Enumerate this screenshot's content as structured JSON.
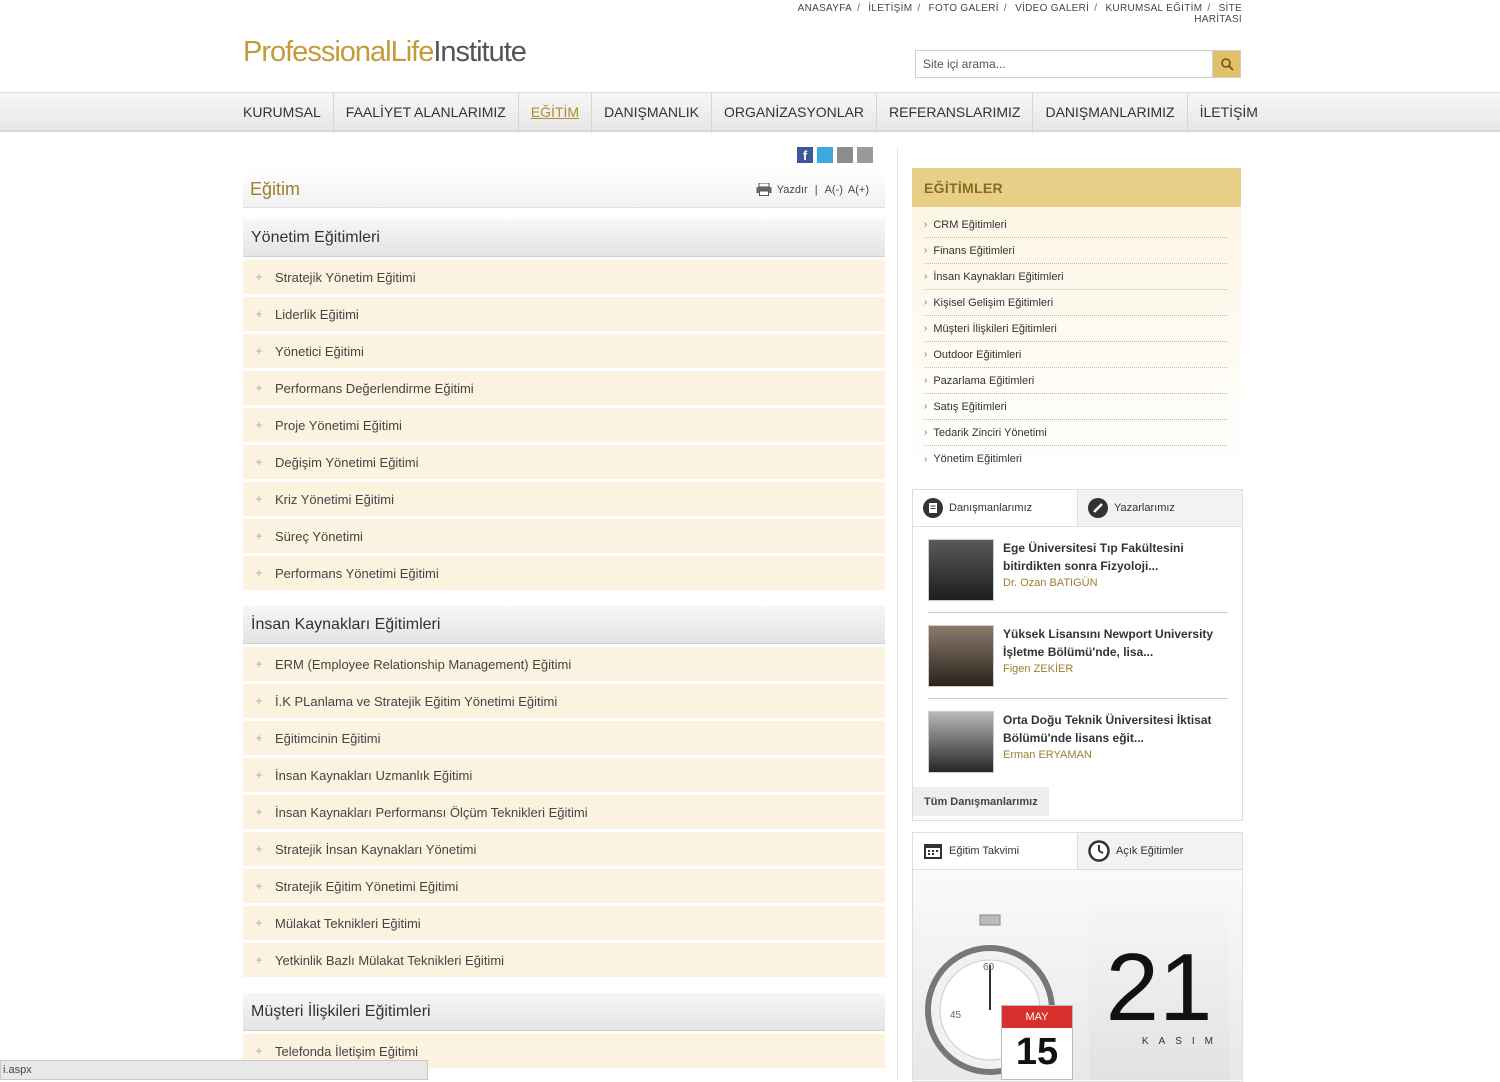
{
  "top_links": [
    "ANASAYFA",
    "İLETİŞİM",
    "FOTO GALERİ",
    "VİDEO GALERİ",
    "KURUMSAL EĞİTİM",
    "SİTE HARİTASI"
  ],
  "logo": {
    "part1": "ProfessionalLife",
    "part2": "Institute"
  },
  "search": {
    "placeholder": "Site içi arama..."
  },
  "nav": [
    "KURUMSAL",
    "FAALİYET ALANLARIMIZ",
    "EĞİTİM",
    "DANIŞMANLIK",
    "ORGANİZASYONLAR",
    "REFERANSLARIMIZ",
    "DANIŞMANLARIMIZ",
    "İLETİŞİM"
  ],
  "page_title": "Eğitim",
  "tools": {
    "print": "Yazdır",
    "sep": "|",
    "small": "A(-)",
    "large": "A(+)"
  },
  "categories": [
    {
      "title": "Yönetim Eğitimleri",
      "items": [
        "Stratejik Yönetim Eğitimi",
        "Liderlik Eğitimi",
        "Yönetici Eğitimi",
        "Performans Değerlendirme Eğitimi",
        "Proje Yönetimi Eğitimi",
        "Değişim Yönetimi Eğitimi",
        "Kriz Yönetimi Eğitimi",
        "Süreç Yönetimi",
        "Performans Yönetimi Eğitimi"
      ]
    },
    {
      "title": "İnsan Kaynakları Eğitimleri",
      "items": [
        "ERM (Employee Relationship Management) Eğitimi",
        "İ.K PLanlama ve Stratejik Eğitim Yönetimi Eğitimi",
        "Eğitimcinin Eğitimi",
        "İnsan Kaynakları Uzmanlık Eğitimi",
        "İnsan Kaynakları Performansı Ölçüm Teknikleri Eğitimi",
        "Stratejik İnsan Kaynakları Yönetimi",
        "Stratejik Eğitim Yönetimi Eğitimi",
        "Mülakat Teknikleri Eğitimi",
        "Yetkinlik Bazlı Mülakat Teknikleri Eğitimi"
      ]
    },
    {
      "title": "Müşteri İlişkileri Eğitimleri",
      "items": [
        "Telefonda İletişim Eğitimi"
      ]
    }
  ],
  "sidebar": {
    "title": "EĞİTİMLER",
    "items": [
      "CRM Eğitimleri",
      "Finans Eğitimleri",
      "İnsan Kaynakları Eğitimleri",
      "Kişisel Gelişim Eğitimleri",
      "Müşteri İlişkileri Eğitimleri",
      "Outdoor Eğitimleri",
      "Pazarlama Eğitimleri",
      "Satış Eğitimleri",
      "Tedarik Zinciri Yönetimi",
      "Yönetim Eğitimleri"
    ]
  },
  "advisors_panel": {
    "tabs": [
      "Danışmanlarımız",
      "Yazarlarımız"
    ],
    "items": [
      {
        "text": "Ege Üniversitesi Tıp Fakültesini bitirdikten sonra Fizyoloji...",
        "name": "Dr. Ozan BATIGÜN"
      },
      {
        "text": "Yüksek Lisansını Newport University İşletme Bölümü'nde, lisa...",
        "name": "Figen ZEKİER"
      },
      {
        "text": "Orta Doğu Teknik Üniversitesi İktisat Bölümü'nde lisans eğit...",
        "name": "Erman ERYAMAN"
      }
    ],
    "all_button": "Tüm Danışmanlarımız"
  },
  "calendar_panel": {
    "tabs": [
      "Eğitim Takvimi",
      "Açık Eğitimler"
    ],
    "day": "21",
    "month": "KASIM",
    "badge_month": "MAY",
    "badge_day": "15"
  },
  "status_bar": "i.aspx",
  "colors": {
    "accent": "#c49a3a",
    "item_bg": "#fbf3df",
    "side_head": "#e8cf88"
  }
}
